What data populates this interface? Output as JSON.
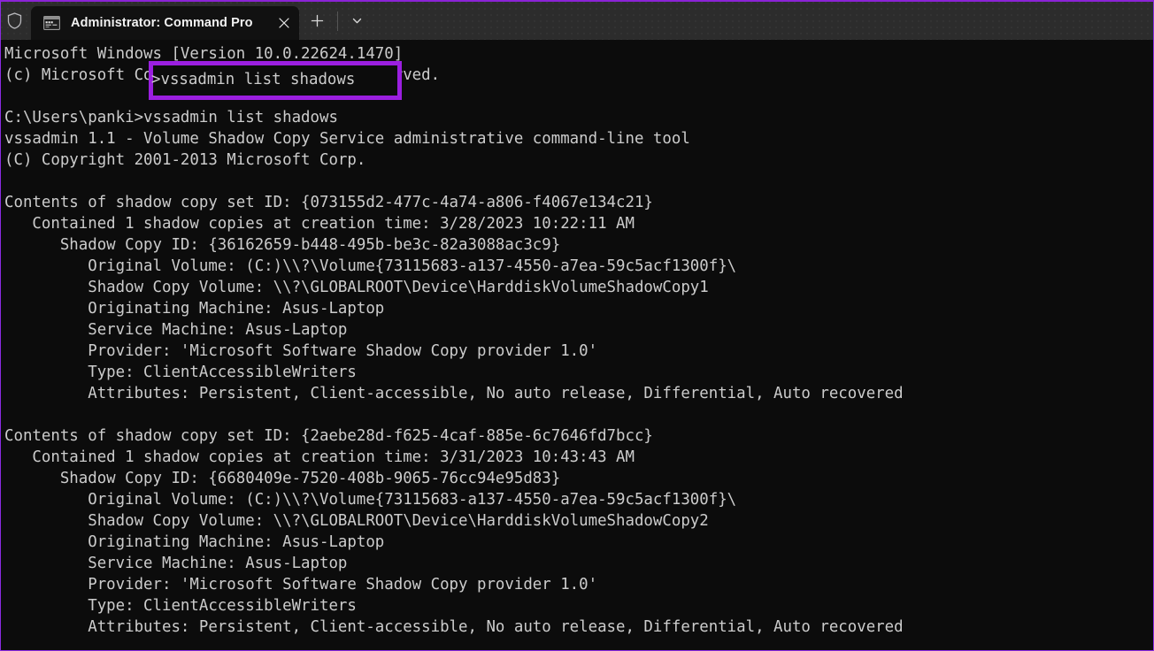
{
  "window": {
    "accent_color": "#9b1fe0",
    "border_color": "#8a2be2",
    "background": "#0c0c0c",
    "titlebar_background": "#2c2c2c"
  },
  "titlebar": {
    "shield_icon": "shield-icon",
    "tab": {
      "icon": "console-window-icon",
      "title": "Administrator: Command Pro",
      "close_icon": "close-icon"
    },
    "new_tab_icon": "plus-icon",
    "dropdown_icon": "chevron-down-icon"
  },
  "terminal": {
    "text_color": "#cccccc",
    "lines": [
      "Microsoft Windows [Version 10.0.22624.1470]",
      "(c) Microsoft Corporation. All rights reserved.",
      "",
      "C:\\Users\\panki>vssadmin list shadows",
      "vssadmin 1.1 - Volume Shadow Copy Service administrative command-line tool",
      "(C) Copyright 2001-2013 Microsoft Corp.",
      "",
      "Contents of shadow copy set ID: {073155d2-477c-4a74-a806-f4067e134c21}",
      "   Contained 1 shadow copies at creation time: 3/28/2023 10:22:11 AM",
      "      Shadow Copy ID: {36162659-b448-495b-be3c-82a3088ac3c9}",
      "         Original Volume: (C:)\\\\?\\Volume{73115683-a137-4550-a7ea-59c5acf1300f}\\",
      "         Shadow Copy Volume: \\\\?\\GLOBALROOT\\Device\\HarddiskVolumeShadowCopy1",
      "         Originating Machine: Asus-Laptop",
      "         Service Machine: Asus-Laptop",
      "         Provider: 'Microsoft Software Shadow Copy provider 1.0'",
      "         Type: ClientAccessibleWriters",
      "         Attributes: Persistent, Client-accessible, No auto release, Differential, Auto recovered",
      "",
      "Contents of shadow copy set ID: {2aebe28d-f625-4caf-885e-6c7646fd7bcc}",
      "   Contained 1 shadow copies at creation time: 3/31/2023 10:43:43 AM",
      "      Shadow Copy ID: {6680409e-7520-408b-9065-76cc94e95d83}",
      "         Original Volume: (C:)\\\\?\\Volume{73115683-a137-4550-a7ea-59c5acf1300f}\\",
      "         Shadow Copy Volume: \\\\?\\GLOBALROOT\\Device\\HarddiskVolumeShadowCopy2",
      "         Originating Machine: Asus-Laptop",
      "         Service Machine: Asus-Laptop",
      "         Provider: 'Microsoft Software Shadow Copy provider 1.0'",
      "         Type: ClientAccessibleWriters",
      "         Attributes: Persistent, Client-accessible, No auto release, Differential, Auto recovered"
    ]
  },
  "annotation": {
    "highlight_color": "#9b1fe0",
    "highlighted_text": ">vssadmin list shadows"
  }
}
